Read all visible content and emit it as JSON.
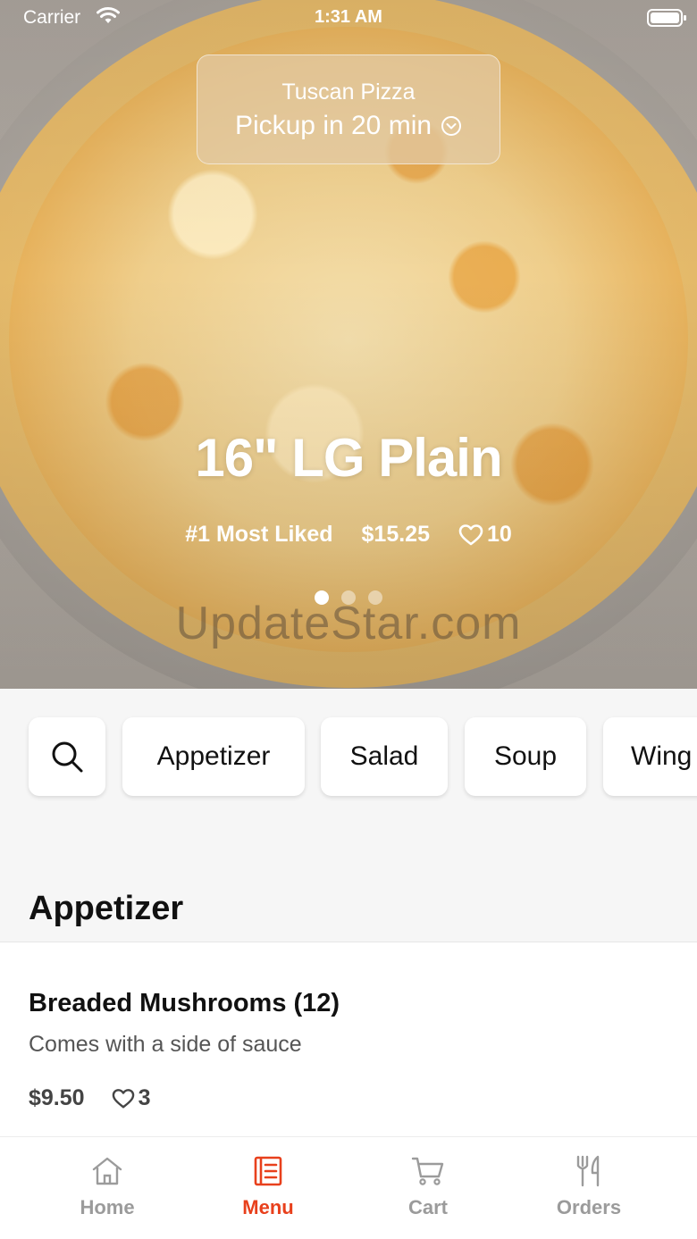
{
  "status_bar": {
    "carrier": "Carrier",
    "time": "1:31 AM"
  },
  "store": {
    "name": "Tuscan Pizza",
    "pickup": "Pickup in 20 min"
  },
  "featured": {
    "title": "16\" LG Plain",
    "rank": "#1 Most Liked",
    "price": "$15.25",
    "likes": "10",
    "carousel_pages": 3,
    "active_page": 1
  },
  "watermark": "UpdateStar.com",
  "categories": [
    "Appetizer",
    "Salad",
    "Soup",
    "Wing"
  ],
  "section": {
    "title": "Appetizer"
  },
  "items": [
    {
      "name": "Breaded Mushrooms (12)",
      "description": "Comes with a side of sauce",
      "price": "$9.50",
      "likes": "3"
    }
  ],
  "tabs": [
    {
      "label": "Home",
      "icon": "home-icon",
      "active": false
    },
    {
      "label": "Menu",
      "icon": "menu-icon",
      "active": true
    },
    {
      "label": "Cart",
      "icon": "cart-icon",
      "active": false
    },
    {
      "label": "Orders",
      "icon": "orders-icon",
      "active": false
    }
  ],
  "colors": {
    "accent": "#e8401c",
    "inactive_tab": "#9b9b9b"
  }
}
